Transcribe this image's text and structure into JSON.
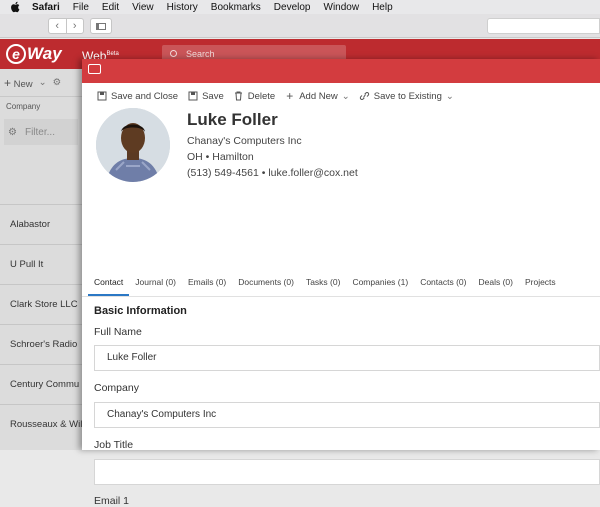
{
  "menubar": {
    "items": [
      "Safari",
      "File",
      "Edit",
      "View",
      "History",
      "Bookmarks",
      "Develop",
      "Window",
      "Help"
    ]
  },
  "app": {
    "logo_text": "Way",
    "logo_letter": "e",
    "web_label": "Web",
    "web_sup": "Beta",
    "search_placeholder": "Search"
  },
  "left_pane": {
    "new_label": "New",
    "column_header": "Company",
    "filter_placeholder": "Filter...",
    "items": [
      "Alabastor",
      "U Pull It",
      "Clark Store LLC",
      "Schroer's Radio",
      "Century Commu",
      "Rousseaux & Wil"
    ]
  },
  "toolbar": {
    "save_close": "Save and Close",
    "save": "Save",
    "delete": "Delete",
    "add_new": "Add New",
    "save_existing": "Save to Existing"
  },
  "contact": {
    "name": "Luke Foller",
    "company": "Chanay's Computers Inc",
    "location": "OH • Hamilton",
    "phone_email": "(513) 549-4561 • luke.foller@cox.net"
  },
  "tabs": [
    "Contact",
    "Journal (0)",
    "Emails (0)",
    "Documents (0)",
    "Tasks (0)",
    "Companies (1)",
    "Contacts (0)",
    "Deals (0)",
    "Projects"
  ],
  "form": {
    "section": "Basic Information",
    "full_name_label": "Full Name",
    "full_name_value": "Luke Foller",
    "company_label": "Company",
    "company_value": "Chanay's Computers Inc",
    "job_title_label": "Job Title",
    "job_title_value": "",
    "email_label": "Email 1"
  },
  "colors": {
    "app_header": "#bd2b2f",
    "window_title": "#d33c3f",
    "tab_active": "#2b78c5"
  }
}
